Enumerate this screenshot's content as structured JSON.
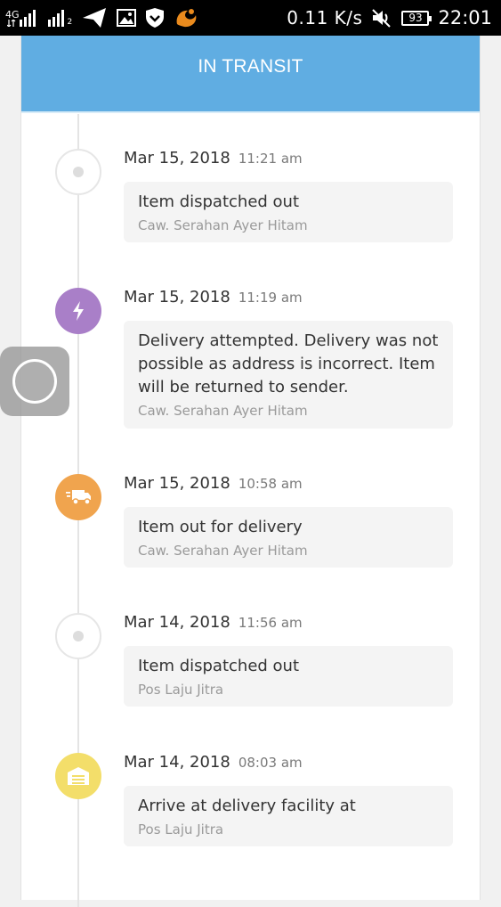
{
  "status_bar": {
    "network_label": "4G",
    "sim2_label": "2",
    "speed": "0.11 K/s",
    "battery": "93",
    "time": "22:01",
    "icons": [
      "signal-icon",
      "signal-icon",
      "location-arrow-icon",
      "image-icon",
      "shield-icon",
      "uc-browser-icon",
      "mute-icon",
      "battery-icon"
    ]
  },
  "header": {
    "title": "IN TRANSIT"
  },
  "events": [
    {
      "date": "Mar 15, 2018",
      "time": "11:21 am",
      "description": "Item dispatched out",
      "location": "Caw. Serahan Ayer Hitam",
      "icon": "dot-icon"
    },
    {
      "date": "Mar 15, 2018",
      "time": "11:19 am",
      "description": "Delivery attempted. Delivery was not possible as address is incorrect. Item will be returned to sender.",
      "location": "Caw. Serahan Ayer Hitam",
      "icon": "lightning-icon",
      "color": "#a97fc8"
    },
    {
      "date": "Mar 15, 2018",
      "time": "10:58 am",
      "description": "Item out for delivery",
      "location": "Caw. Serahan Ayer Hitam",
      "icon": "delivery-truck-icon",
      "color": "#f0a44e"
    },
    {
      "date": "Mar 14, 2018",
      "time": "11:56 am",
      "description": "Item dispatched out",
      "location": "Pos Laju Jitra",
      "icon": "dot-icon"
    },
    {
      "date": "Mar 14, 2018",
      "time": "08:03 am",
      "description": "Arrive at delivery facility at",
      "location": "Pos Laju Jitra",
      "icon": "warehouse-icon",
      "color": "#f3de6a"
    }
  ],
  "colors": {
    "header": "#60ade2",
    "timeline": "#e4e4e4",
    "bubble": "#f4f4f4"
  }
}
